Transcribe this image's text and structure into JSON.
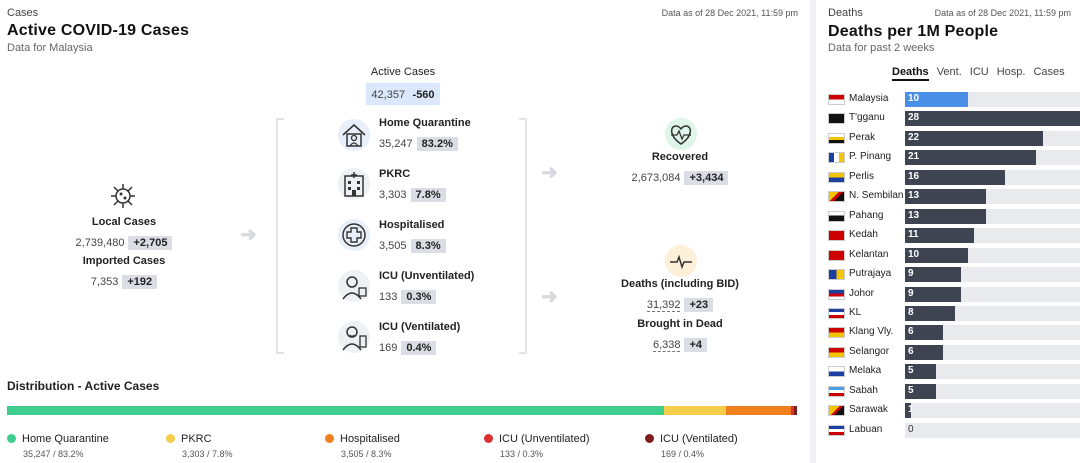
{
  "cases": {
    "section": "Cases",
    "title": "Active COVID-19 Cases",
    "subtitle": "Data for Malaysia",
    "as_of": "Data as of 28 Dec 2021, 11:59 pm",
    "active": {
      "label": "Active Cases",
      "value": "42,357",
      "change": "-560"
    },
    "local": {
      "label": "Local Cases",
      "value": "2,739,480",
      "change": "+2,705"
    },
    "imported": {
      "label": "Imported Cases",
      "value": "7,353",
      "change": "+192"
    },
    "home_quarantine": {
      "label": "Home Quarantine",
      "value": "35,247",
      "pct": "83.2%"
    },
    "pkrc": {
      "label": "PKRC",
      "value": "3,303",
      "pct": "7.8%"
    },
    "hospitalised": {
      "label": "Hospitalised",
      "value": "3,505",
      "pct": "8.3%"
    },
    "icu_unvent": {
      "label": "ICU (Unventilated)",
      "value": "133",
      "pct": "0.3%"
    },
    "icu_vent": {
      "label": "ICU (Ventilated)",
      "value": "169",
      "pct": "0.4%"
    },
    "recovered": {
      "label": "Recovered",
      "value": "2,673,084",
      "change": "+3,434"
    },
    "deaths": {
      "label": "Deaths (including BID)",
      "value": "31,392",
      "change": "+23"
    },
    "bid": {
      "label": "Brought in Dead",
      "value": "6,338",
      "change": "+4"
    }
  },
  "distribution": {
    "title": "Distribution - Active Cases",
    "segments": [
      {
        "name": "Home Quarantine",
        "value": 35247,
        "sub": "35,247 / 83.2%",
        "color": "#3ecf8e"
      },
      {
        "name": "PKRC",
        "value": 3303,
        "sub": "3,303 / 7.8%",
        "color": "#f5cd48"
      },
      {
        "name": "Hospitalised",
        "value": 3505,
        "sub": "3,505 / 8.3%",
        "color": "#f07f1e"
      },
      {
        "name": "ICU (Unventilated)",
        "value": 133,
        "sub": "133 / 0.3%",
        "color": "#dc2f2f"
      },
      {
        "name": "ICU (Ventilated)",
        "value": 169,
        "sub": "169 / 0.4%",
        "color": "#7d1d1d"
      }
    ]
  },
  "deaths_panel": {
    "section": "Deaths",
    "as_of": "Data as of 28 Dec 2021, 11:59 pm",
    "title": "Deaths per 1M People",
    "subtitle": "Data for past 2 weeks",
    "tabs": [
      "Deaths",
      "Vent.",
      "ICU",
      "Hosp.",
      "Cases"
    ],
    "active_tab": "Deaths"
  },
  "chart_data": {
    "type": "bar",
    "orientation": "horizontal",
    "categories": [
      "Malaysia",
      "T'gganu",
      "Perak",
      "P. Pinang",
      "Perlis",
      "N. Sembilan",
      "Pahang",
      "Kedah",
      "Kelantan",
      "Putrajaya",
      "Johor",
      "KL",
      "Klang Vly.",
      "Selangor",
      "Melaka",
      "Sabah",
      "Sarawak",
      "Labuan"
    ],
    "values": [
      10,
      28,
      22,
      21,
      16,
      13,
      13,
      11,
      10,
      9,
      9,
      8,
      6,
      6,
      5,
      5,
      1,
      0
    ],
    "max": 28,
    "highlight": "Malaysia",
    "colors": {
      "bar": "#3f4452",
      "highlight": "#4a8fe7",
      "track": "#e9eaee"
    }
  }
}
